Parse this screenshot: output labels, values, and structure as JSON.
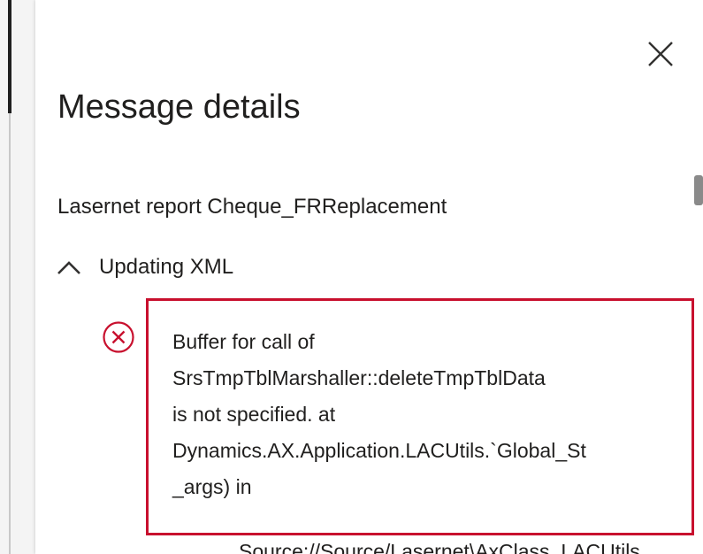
{
  "dialog": {
    "title": "Message details",
    "report_name": "Lasernet report Cheque_FRReplacement",
    "section": {
      "label": "Updating XML",
      "expanded": true
    },
    "error": {
      "icon": "error-circle-icon",
      "lines": [
        "Buffer for call of",
        "SrsTmpTblMarshaller::deleteTmpTblData",
        "is not specified. at",
        "Dynamics.AX.Application.LACUtils.`Global_St",
        "_args) in"
      ],
      "cut_off_line": "Source://Source/Lasernet\\AxClass_LACUtils"
    }
  },
  "colors": {
    "error_red": "#c8102e",
    "highlight_border": "#c8102e",
    "text": "#201f1e"
  },
  "icons": {
    "close": "close-icon",
    "chevron": "chevron-up-icon",
    "error": "error-circle-icon"
  }
}
